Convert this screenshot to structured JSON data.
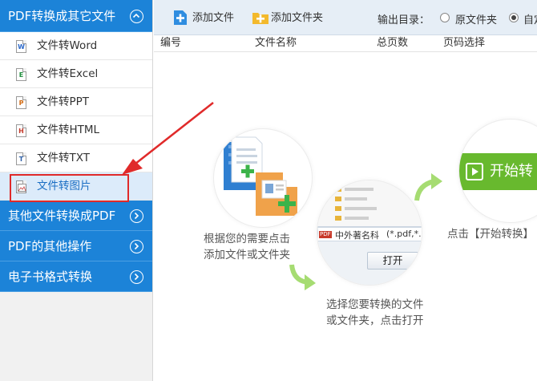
{
  "sidebar": {
    "category1": "PDF转换成其它文件",
    "items": [
      {
        "label": "文件转Word",
        "icon": "word-file-icon",
        "glyph": "W"
      },
      {
        "label": "文件转Excel",
        "icon": "excel-file-icon",
        "glyph": "E"
      },
      {
        "label": "文件转PPT",
        "icon": "ppt-file-icon",
        "glyph": "P"
      },
      {
        "label": "文件转HTML",
        "icon": "html-file-icon",
        "glyph": "H"
      },
      {
        "label": "文件转TXT",
        "icon": "txt-file-icon",
        "glyph": "T"
      },
      {
        "label": "文件转图片",
        "icon": "image-file-icon",
        "glyph": ""
      }
    ],
    "active_index": 5,
    "category2": "其他文件转换成PDF",
    "category3": "PDF的其他操作",
    "category4": "电子书格式转换"
  },
  "toolbar": {
    "add_file": "添加文件",
    "add_folder": "添加文件夹",
    "output_label": "输出目录：",
    "option_source": "原文件夹",
    "option_custom": "自定"
  },
  "table": {
    "columns": [
      "编号",
      "文件名称",
      "总页数",
      "页码选择"
    ]
  },
  "guide": {
    "step1_line1": "根据您的需要点击",
    "step1_line2": "添加文件或文件夹",
    "step2_line1": "选择您要转换的文件",
    "step2_line2": "或文件夹，点击打开",
    "step3_line1": "点击【开始转换】",
    "dialog_file_text": "中外著名科",
    "dialog_filter_text": "(*.pdf,*.",
    "dialog_pdf_badge": "PDF",
    "dialog_open": "打开",
    "start_button": "开始转"
  },
  "colors": {
    "sidebar_blue": "#1c83d8",
    "active_item": "#dcebfa",
    "highlight_red": "#e02a2a",
    "start_green": "#68b92e",
    "arrow_green": "#a6dc72"
  }
}
